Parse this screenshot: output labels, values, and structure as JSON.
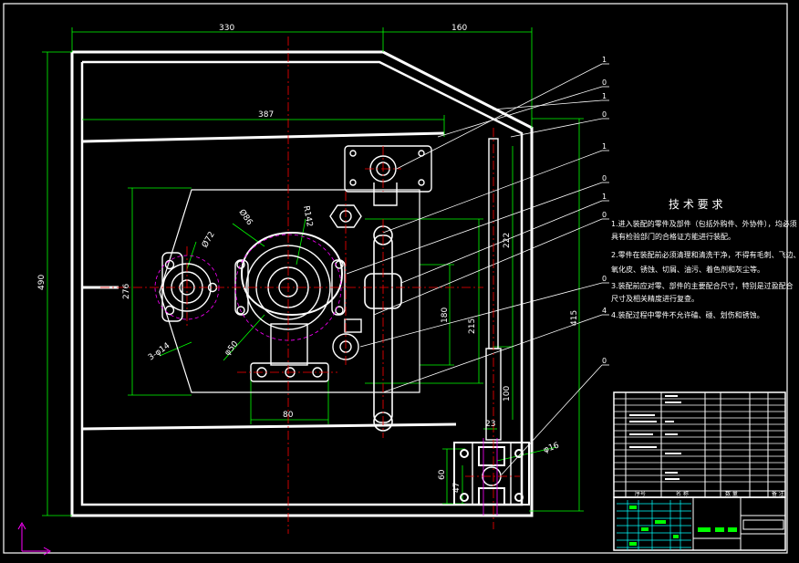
{
  "dimensions": {
    "top_left": "330",
    "top_right": "160",
    "inner_width": "387",
    "overall_height": "490",
    "side_height": "276",
    "right_height": "415",
    "rod_height_upper": "222",
    "rod_height_lower": "100",
    "center_offset": "215",
    "mid_height": "180",
    "bottom_width": "80",
    "small_gap": "23",
    "clamp_height": "60",
    "clamp_small": "47",
    "dia_72": "Ø72",
    "dia_86": "Ø86",
    "r_142": "R142",
    "dia_50": "φ50",
    "holes": "3-φ14",
    "dia_16": "φ16"
  },
  "tech": {
    "title": "技 术 要 求",
    "line1": "1.进入装配的零件及部件（包括外购件、外协件），均必须",
    "line1b": "具有检验部门的合格证方能进行装配。",
    "line2": "2.零件在装配前必须清理和清洗干净，不得有毛刺、飞边、",
    "line2b": "氧化皮、锈蚀、切屑、油污、着色剂和灰尘等。",
    "line3": "3.装配前应对零、部件的主要配合尺寸，特别是过盈配合",
    "line3b": "尺寸及相关精度进行复查。",
    "line4": "4.装配过程中零件不允许磕、碰、划伤和锈蚀。"
  },
  "bom": {
    "col1": "序号",
    "col2": "名 称",
    "col3": "数 量",
    "col4": "备 注"
  },
  "colors": {
    "background": "#000000",
    "outline": "#ffffff",
    "dimension": "#00ff00",
    "centerline": "#ff0000",
    "hidden": "#ff00ff",
    "highlight": "#ffff00",
    "axis": "#ff00ff"
  }
}
